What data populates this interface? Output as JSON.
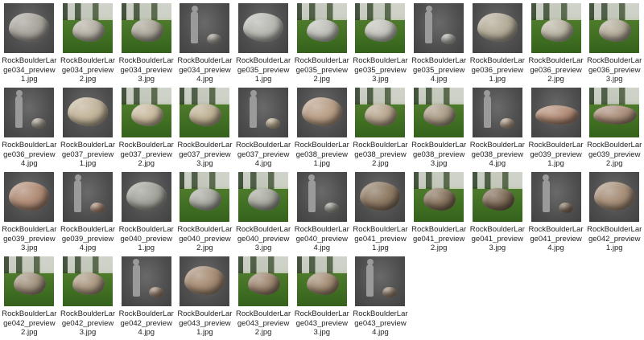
{
  "files": [
    {
      "name": "RockBoulderLarge034_preview1.jpg",
      "bg": "gray",
      "rock": "#a8a49c",
      "human": false,
      "shape": "big"
    },
    {
      "name": "RockBoulderLarge034_preview2.jpg",
      "bg": "grass",
      "rock": "#b4afa4",
      "human": false,
      "shape": "mid"
    },
    {
      "name": "RockBoulderLarge034_preview3.jpg",
      "bg": "grass",
      "rock": "#aaa598",
      "human": false,
      "shape": "mid"
    },
    {
      "name": "RockBoulderLarge034_preview4.jpg",
      "bg": "gray",
      "rock": "#a39e94",
      "human": true,
      "shape": "small"
    },
    {
      "name": "RockBoulderLarge035_preview1.jpg",
      "bg": "gray",
      "rock": "#b8b8b2",
      "human": false,
      "shape": "big"
    },
    {
      "name": "RockBoulderLarge035_preview2.jpg",
      "bg": "grass",
      "rock": "#bdbdb6",
      "human": false,
      "shape": "mid"
    },
    {
      "name": "RockBoulderLarge035_preview3.jpg",
      "bg": "grass",
      "rock": "#c2c2ba",
      "human": false,
      "shape": "mid"
    },
    {
      "name": "RockBoulderLarge035_preview4.jpg",
      "bg": "gray",
      "rock": "#b0b0aa",
      "human": true,
      "shape": "small"
    },
    {
      "name": "RockBoulderLarge036_preview1.jpg",
      "bg": "gray",
      "rock": "#b3ab98",
      "human": false,
      "shape": "big"
    },
    {
      "name": "RockBoulderLarge036_preview2.jpg",
      "bg": "grass",
      "rock": "#b9b3a2",
      "human": false,
      "shape": "mid"
    },
    {
      "name": "RockBoulderLarge036_preview3.jpg",
      "bg": "grass",
      "rock": "#b2ab98",
      "human": false,
      "shape": "mid"
    },
    {
      "name": "RockBoulderLarge036_preview4.jpg",
      "bg": "gray",
      "rock": "#a9a294",
      "human": true,
      "shape": "small"
    },
    {
      "name": "RockBoulderLarge037_preview1.jpg",
      "bg": "gray",
      "rock": "#c2b49a",
      "human": false,
      "shape": "big"
    },
    {
      "name": "RockBoulderLarge037_preview2.jpg",
      "bg": "grass",
      "rock": "#c7b89c",
      "human": false,
      "shape": "mid"
    },
    {
      "name": "RockBoulderLarge037_preview3.jpg",
      "bg": "grass",
      "rock": "#bcae90",
      "human": false,
      "shape": "mid"
    },
    {
      "name": "RockBoulderLarge037_preview4.jpg",
      "bg": "gray",
      "rock": "#bfb294",
      "human": true,
      "shape": "small"
    },
    {
      "name": "RockBoulderLarge038_preview1.jpg",
      "bg": "gray",
      "rock": "#b89e86",
      "human": false,
      "shape": "big"
    },
    {
      "name": "RockBoulderLarge038_preview2.jpg",
      "bg": "grass",
      "rock": "#b6a48c",
      "human": false,
      "shape": "mid"
    },
    {
      "name": "RockBoulderLarge038_preview3.jpg",
      "bg": "grass",
      "rock": "#a89a84",
      "human": false,
      "shape": "mid"
    },
    {
      "name": "RockBoulderLarge038_preview4.jpg",
      "bg": "gray",
      "rock": "#b29c86",
      "human": true,
      "shape": "small"
    },
    {
      "name": "RockBoulderLarge039_preview1.jpg",
      "bg": "gray",
      "rock": "#b08a74",
      "human": false,
      "shape": "flat"
    },
    {
      "name": "RockBoulderLarge039_preview2.jpg",
      "bg": "grass",
      "rock": "#a88c78",
      "human": false,
      "shape": "flat"
    },
    {
      "name": "RockBoulderLarge039_preview3.jpg",
      "bg": "gray",
      "rock": "#b08c76",
      "human": false,
      "shape": "big"
    },
    {
      "name": "RockBoulderLarge039_preview4.jpg",
      "bg": "gray",
      "rock": "#aa8a74",
      "human": true,
      "shape": "small"
    },
    {
      "name": "RockBoulderLarge040_preview1.jpg",
      "bg": "gray",
      "rock": "#a2a39a",
      "human": false,
      "shape": "big"
    },
    {
      "name": "RockBoulderLarge040_preview2.jpg",
      "bg": "grass",
      "rock": "#a7a89e",
      "human": false,
      "shape": "mid"
    },
    {
      "name": "RockBoulderLarge040_preview3.jpg",
      "bg": "grass",
      "rock": "#a4a59a",
      "human": false,
      "shape": "mid"
    },
    {
      "name": "RockBoulderLarge040_preview4.jpg",
      "bg": "gray",
      "rock": "#9c9d94",
      "human": true,
      "shape": "small"
    },
    {
      "name": "RockBoulderLarge041_preview1.jpg",
      "bg": "gray",
      "rock": "#8e7a64",
      "human": false,
      "shape": "big"
    },
    {
      "name": "RockBoulderLarge041_preview2.jpg",
      "bg": "grass",
      "rock": "#86725c",
      "human": false,
      "shape": "mid"
    },
    {
      "name": "RockBoulderLarge041_preview3.jpg",
      "bg": "grass",
      "rock": "#7e6a56",
      "human": false,
      "shape": "mid"
    },
    {
      "name": "RockBoulderLarge041_preview4.jpg",
      "bg": "gray",
      "rock": "#887460",
      "human": true,
      "shape": "small"
    },
    {
      "name": "RockBoulderLarge042_preview1.jpg",
      "bg": "gray",
      "rock": "#a68e78",
      "human": false,
      "shape": "big"
    },
    {
      "name": "RockBoulderLarge042_preview2.jpg",
      "bg": "grass",
      "rock": "#a0907c",
      "human": false,
      "shape": "mid"
    },
    {
      "name": "RockBoulderLarge042_preview3.jpg",
      "bg": "grass",
      "rock": "#a8967e",
      "human": false,
      "shape": "mid"
    },
    {
      "name": "RockBoulderLarge042_preview4.jpg",
      "bg": "gray",
      "rock": "#a08a74",
      "human": true,
      "shape": "small"
    },
    {
      "name": "RockBoulderLarge043_preview1.jpg",
      "bg": "gray",
      "rock": "#a58b74",
      "human": false,
      "shape": "big"
    },
    {
      "name": "RockBoulderLarge043_preview2.jpg",
      "bg": "grass",
      "rock": "#9c846e",
      "human": false,
      "shape": "mid"
    },
    {
      "name": "RockBoulderLarge043_preview3.jpg",
      "bg": "grass",
      "rock": "#a28a72",
      "human": false,
      "shape": "mid"
    },
    {
      "name": "RockBoulderLarge043_preview4.jpg",
      "bg": "gray",
      "rock": "#9a8470",
      "human": true,
      "shape": "small"
    }
  ]
}
